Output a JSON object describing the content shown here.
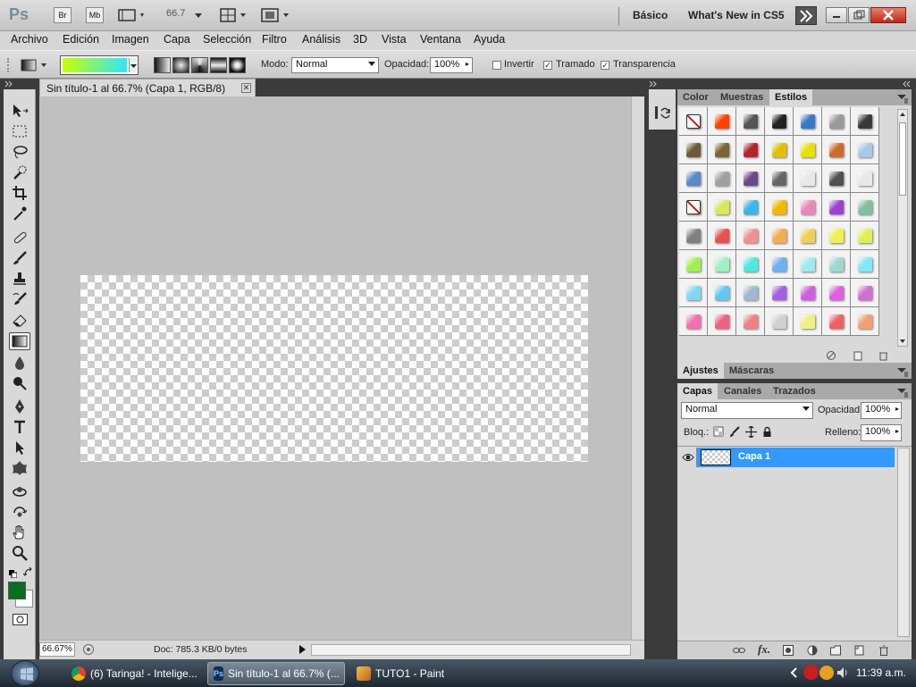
{
  "appbar": {
    "ps_logo": "Ps",
    "bridge": "Br",
    "minibridge": "Mb",
    "zoom": "66.7",
    "workspace": "Básico",
    "whats_new": "What's New in CS5"
  },
  "menu": [
    "Archivo",
    "Edición",
    "Imagen",
    "Capa",
    "Selección",
    "Filtro",
    "Análisis",
    "3D",
    "Vista",
    "Ventana",
    "Ayuda"
  ],
  "options": {
    "mode_label": "Modo:",
    "mode_value": "Normal",
    "opacity_label": "Opacidad:",
    "opacity_value": "100%",
    "invert_label": "Invertir",
    "invert_checked": false,
    "dither_label": "Tramado",
    "dither_checked": true,
    "transparency_label": "Transparencia",
    "transparency_checked": true,
    "gradient_colors": [
      "#c8ff00",
      "#2fe5ff"
    ]
  },
  "document": {
    "tab_title": "Sin título-1 al 66.7% (Capa 1, RGB/8)",
    "zoom": "66.67%",
    "doc_info": "Doc: 785.3 KB/0 bytes"
  },
  "colors": {
    "foreground": "#0a6e1e",
    "background": "#ffffff",
    "highlight": "#3399ff"
  },
  "styles_panel": {
    "tabs": [
      "Color",
      "Muestras",
      "Estilos"
    ],
    "active_tab": "Estilos",
    "swatches": [
      "none",
      "#ff4400",
      "#555555",
      "#222222",
      "#3a78c8",
      "#9a9a9a",
      "#3a3a3a",
      "#6b5a3a",
      "#7a6532",
      "#b5242d",
      "#e0c000",
      "#e8e000",
      "#d06a2a",
      "#a8c8e8",
      "#5a88c8",
      "#a0a0a0",
      "#6a4a8a",
      "#666666",
      "#e8e8e8",
      "#505050",
      "#e8e8e8",
      "none",
      "#d8e85a",
      "#3ab5e8",
      "#f2b800",
      "#e888b8",
      "#a040d0",
      "#80c0a0",
      "#808080",
      "#e85050",
      "#f09090",
      "#f0b050",
      "#f0d050",
      "#f0f050",
      "#e0f050",
      "#a0f050",
      "#a0f0c0",
      "#50e8e0",
      "#70b0f0",
      "#a0e8f0",
      "#a0d8d0",
      "#80e8f8",
      "#80d8f0",
      "#60c8f0",
      "#a0b8d0",
      "#a060e0",
      "#d060e0",
      "#e060e0",
      "#d070d0",
      "#f070b0",
      "#f06080",
      "#f08080",
      "#d0d0d0",
      "#f0f080",
      "#f06060",
      "#f0a070"
    ]
  },
  "adjust_panel": {
    "tabs": [
      "Ajustes",
      "Máscaras"
    ],
    "active_tab": "Ajustes"
  },
  "layers_panel": {
    "tabs": [
      "Capas",
      "Canales",
      "Trazados"
    ],
    "active_tab": "Capas",
    "blend_mode": "Normal",
    "opacity_label": "Opacidad:",
    "opacity_value": "100%",
    "lock_label": "Bloq.:",
    "fill_label": "Relleno:",
    "fill_value": "100%",
    "layers": [
      {
        "name": "Capa 1",
        "visible": true,
        "selected": true
      }
    ]
  },
  "taskbar": {
    "items": [
      {
        "label": "(6) Taringa! - Intelige...",
        "icon": "chrome-icon",
        "active": false
      },
      {
        "label": "Sin título-1 al 66.7% (...",
        "icon": "photoshop-icon",
        "active": true
      },
      {
        "label": "TUTO1 - Paint",
        "icon": "paint-icon",
        "active": false
      }
    ],
    "clock": "11:39 a.m."
  }
}
